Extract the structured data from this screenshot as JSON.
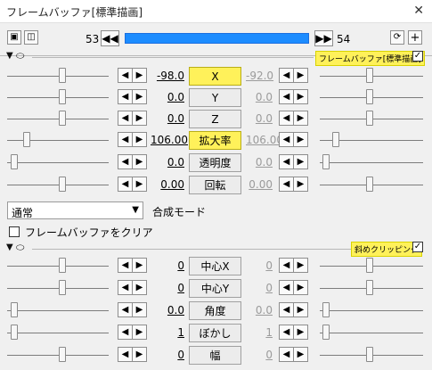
{
  "window": {
    "title": "フレームバッファ[標準描画]"
  },
  "toolbar": {
    "frame_start": "53",
    "frame_end": "54"
  },
  "filters": {
    "first": {
      "tag": "フレームバッファ[標準描画]",
      "rows": [
        {
          "value": "-98.0",
          "label": "X",
          "right": "-92.0",
          "highlight": true
        },
        {
          "value": "0.0",
          "label": "Y",
          "right": "0.0",
          "highlight": false
        },
        {
          "value": "0.0",
          "label": "Z",
          "right": "0.0",
          "highlight": false
        },
        {
          "value": "106.00",
          "label": "拡大率",
          "right": "106.00",
          "highlight": true
        },
        {
          "value": "0.0",
          "label": "透明度",
          "right": "0.0",
          "highlight": false
        },
        {
          "value": "0.00",
          "label": "回転",
          "right": "0.00",
          "highlight": false
        }
      ],
      "blend_mode": {
        "selected": "通常",
        "caption": "合成モード"
      },
      "clear_checkbox": "フレームバッファをクリア"
    },
    "second": {
      "tag": "斜めクリッピング",
      "rows": [
        {
          "value": "0",
          "label": "中心X",
          "right": "0"
        },
        {
          "value": "0",
          "label": "中心Y",
          "right": "0"
        },
        {
          "value": "0.0",
          "label": "角度",
          "right": "0.0"
        },
        {
          "value": "1",
          "label": "ぼかし",
          "right": "1"
        },
        {
          "value": "0",
          "label": "幅",
          "right": "0"
        }
      ]
    }
  }
}
